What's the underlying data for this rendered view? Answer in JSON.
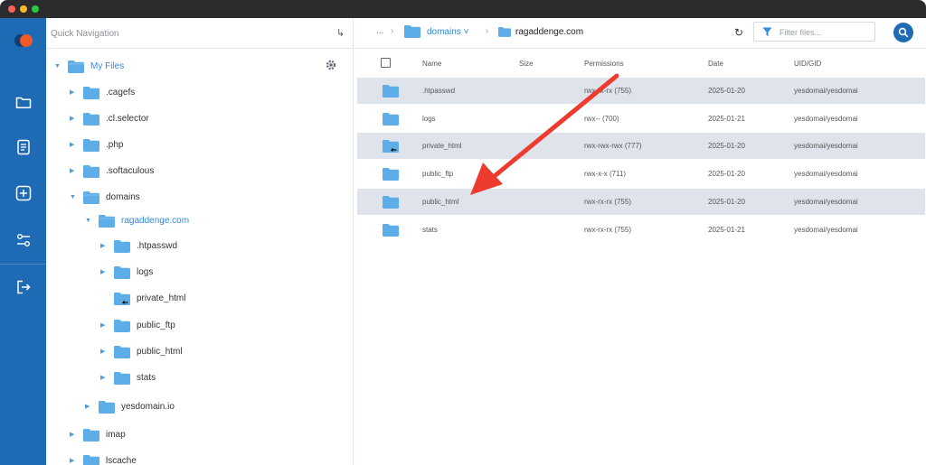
{
  "colors": {
    "rail": "#1f6ab4",
    "folder": "#5dade8",
    "link": "#2d8ae0",
    "row_shade": "#dfe4ec",
    "annotation_arrow": "#ee3b2f"
  },
  "window": {
    "controls": [
      "close",
      "minimize",
      "zoom"
    ]
  },
  "rail": {
    "items": [
      {
        "icon": "folder-icon"
      },
      {
        "icon": "document-icon"
      },
      {
        "icon": "add-box-icon"
      },
      {
        "icon": "sliders-icon"
      },
      {
        "icon": "logout-icon"
      }
    ]
  },
  "sidebar": {
    "quick_nav_label": "Quick Navigation",
    "root_label": "My Files",
    "items": [
      {
        "label": ".cagefs"
      },
      {
        "label": ".cl.selector"
      },
      {
        "label": ".php"
      },
      {
        "label": ".softaculous"
      },
      {
        "label": "domains"
      },
      {
        "label": "ragaddenge.com"
      },
      {
        "label": ".htpasswd"
      },
      {
        "label": "logs"
      },
      {
        "label": "private_html"
      },
      {
        "label": "public_ftp"
      },
      {
        "label": "public_html"
      },
      {
        "label": "stats"
      },
      {
        "label": "yesdomain.io"
      },
      {
        "label": "imap"
      },
      {
        "label": "lscache"
      }
    ]
  },
  "breadcrumb": {
    "ellipsis": "...",
    "items": [
      {
        "label": "domains ˅"
      },
      {
        "label": "ragaddenge.com"
      }
    ]
  },
  "filter": {
    "placeholder": "Filter files..."
  },
  "table": {
    "columns": [
      "Name",
      "Size",
      "Permissions",
      "Date",
      "UID/GID"
    ],
    "rows": [
      {
        "name": ".htpasswd",
        "size": "",
        "permissions": "rwx-rx-rx (755)",
        "date": "2025-01-20",
        "owner": "yesdomai/yesdomai",
        "shaded": true,
        "link": false
      },
      {
        "name": "logs",
        "size": "",
        "permissions": "rwx-- (700)",
        "date": "2025-01-21",
        "owner": "yesdomai/yesdomai",
        "shaded": false,
        "link": false
      },
      {
        "name": "private_html",
        "size": "",
        "permissions": "rwx-rwx-rwx (777)",
        "date": "2025-01-20",
        "owner": "yesdomai/yesdomai",
        "shaded": true,
        "link": true
      },
      {
        "name": "public_ftp",
        "size": "",
        "permissions": "rwx-x-x (711)",
        "date": "2025-01-20",
        "owner": "yesdomai/yesdomai",
        "shaded": false,
        "link": false
      },
      {
        "name": "public_html",
        "size": "",
        "permissions": "rwx-rx-rx (755)",
        "date": "2025-01-20",
        "owner": "yesdomai/yesdomai",
        "shaded": true,
        "link": false
      },
      {
        "name": "stats",
        "size": "",
        "permissions": "rwx-rx-rx (755)",
        "date": "2025-01-21",
        "owner": "yesdomai/yesdomai",
        "shaded": false,
        "link": false
      }
    ]
  }
}
